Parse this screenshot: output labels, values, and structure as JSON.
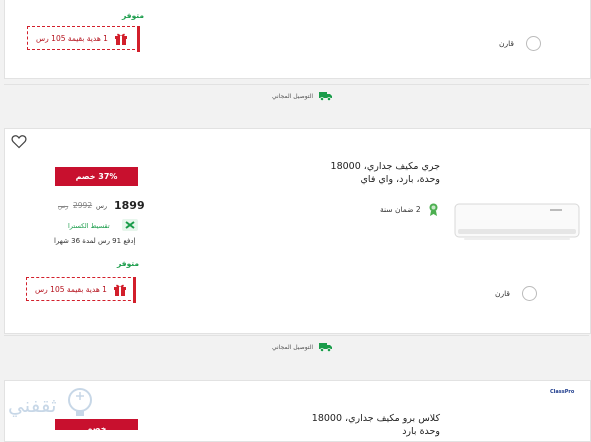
{
  "colors": {
    "accent": "#c8102e",
    "success": "#1a9c4a",
    "background": "#f2f2f2"
  },
  "shipping_label": "التوصيل المجاني",
  "products": [
    {
      "availability": "متوفر",
      "gift_label": "1 هدية بقيمة 105 رس",
      "compare_label": "قارن"
    },
    {
      "title": "جري مكيف جداري، 18000 وحدة، بارد، واي فاي",
      "discount": "37% خصم",
      "price": "1899",
      "currency": "رس",
      "old_price": "2992",
      "old_currency": "رس",
      "installment_provider": "تقسيط الكسترا",
      "installment_text": "إدفع 91 رس لمدة 36 شهرا",
      "warranty": "2 ضمان سنة",
      "availability": "متوفر",
      "gift_label": "1 هدية بقيمة 105 رس",
      "compare_label": "قارن",
      "icon_wishlist": "heart-icon"
    },
    {
      "title": "كلاس برو مكيف جداري، 18000 وحدة بارد",
      "brand_logo": "ClassPro",
      "discount": "خصم"
    }
  ],
  "watermark": "ثقفني"
}
